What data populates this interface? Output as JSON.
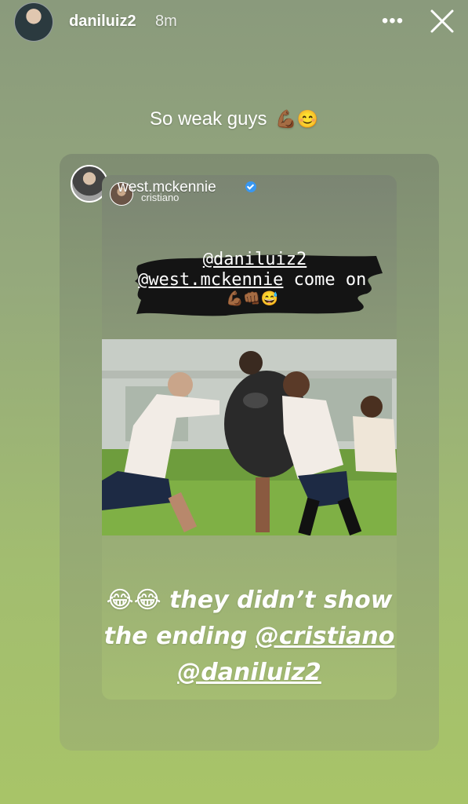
{
  "story": {
    "username": "daniluiz2",
    "time_ago": "8m",
    "caption": "So weak guys",
    "caption_emojis": "💪🏾😊",
    "more_icon": "more-horizontal-icon",
    "close_icon": "close-icon"
  },
  "reshared_post": {
    "username": "west.mckennie",
    "verified": true,
    "sub_username": "cristiano",
    "brush_text": {
      "mention_line1": "@daniluiz2",
      "mention_line2": "@west.mckennie",
      "text_line2": " come on",
      "emojis": "💪🏾👊🏾😅"
    },
    "photo_alt": "training photo",
    "caption": {
      "emojis": "😂😂",
      "text1": " they didn’t show",
      "text2": "the ending ",
      "mention1": "@cristiano",
      "mention2": "@daniluiz2"
    }
  },
  "colors": {
    "verified": "#3897f0",
    "text": "#ffffff"
  }
}
